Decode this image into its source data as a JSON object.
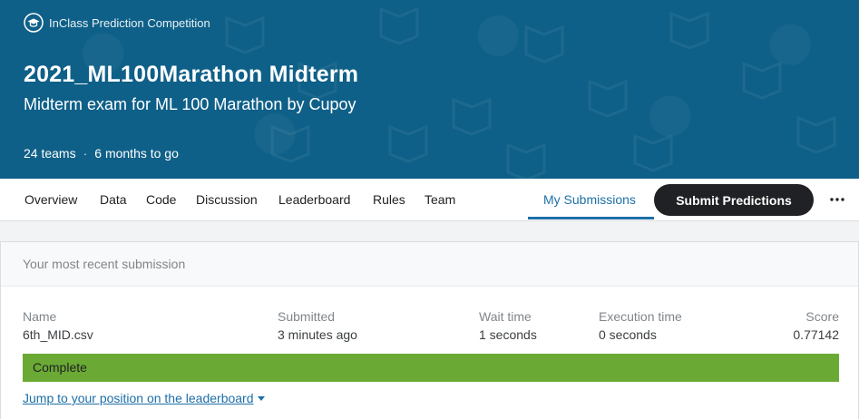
{
  "header": {
    "competition_type": "InClass Prediction Competition",
    "competition_type_icon": "graduation-cap-icon",
    "title": "2021_ML100Marathon Midterm",
    "subtitle": "Midterm exam for ML 100 Marathon by Cupoy",
    "teams": "24 teams",
    "separator": "·",
    "deadline": "6 months to go",
    "background_color": "#0f6088"
  },
  "nav": {
    "tabs": [
      {
        "label": "Overview"
      },
      {
        "label": "Data"
      },
      {
        "label": "Code"
      },
      {
        "label": "Discussion"
      },
      {
        "label": "Leaderboard"
      },
      {
        "label": "Rules"
      },
      {
        "label": "Team"
      },
      {
        "label": "My Submissions",
        "active": true
      }
    ],
    "submit_button": "Submit Predictions",
    "more_icon": "more-horizontal-icon",
    "accent_color": "#1e6fa8"
  },
  "submission": {
    "header": "Your most recent submission",
    "name_label": "Name",
    "name_value": "6th_MID.csv",
    "submitted_label": "Submitted",
    "submitted_value": "3 minutes ago",
    "wait_label": "Wait time",
    "wait_value": "1 seconds",
    "exec_label": "Execution time",
    "exec_value": "0 seconds",
    "score_label": "Score",
    "score_value": "0.77142",
    "status": "Complete",
    "status_color": "#6aaa34",
    "jump_link": "Jump to your position on the leaderboard"
  }
}
